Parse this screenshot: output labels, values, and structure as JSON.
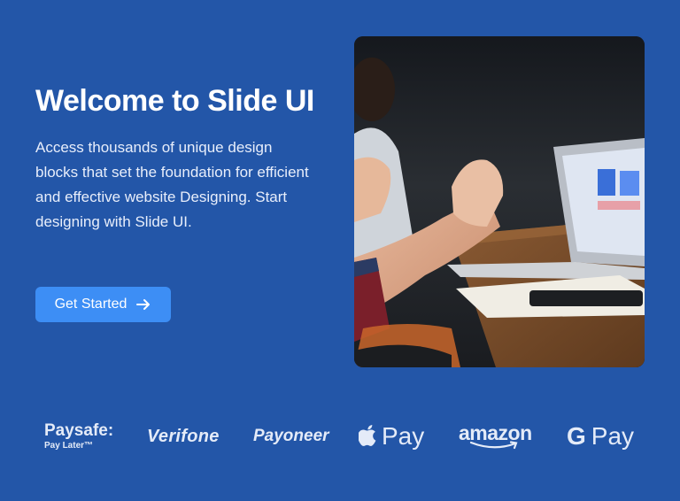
{
  "hero": {
    "title": "Welcome to Slide UI",
    "description": "Access thousands of unique design blocks that set the foundation for efficient and effective website Designing. Start designing with Slide UI.",
    "cta_label": "Get Started",
    "cta_icon": "arrow-right-icon"
  },
  "image": {
    "subject": "team-meeting-photo"
  },
  "logos": {
    "paysafe": "Paysafe:",
    "paysafe_sub": "Pay Later™",
    "verifone": "Verifone",
    "payoneer": "Payoneer",
    "apple_pay": "Pay",
    "amazon": "amazon",
    "google_pay_g": "G",
    "google_pay": "Pay"
  },
  "colors": {
    "background": "#2356a8",
    "button": "#3d8ef5",
    "text": "#ffffff"
  }
}
